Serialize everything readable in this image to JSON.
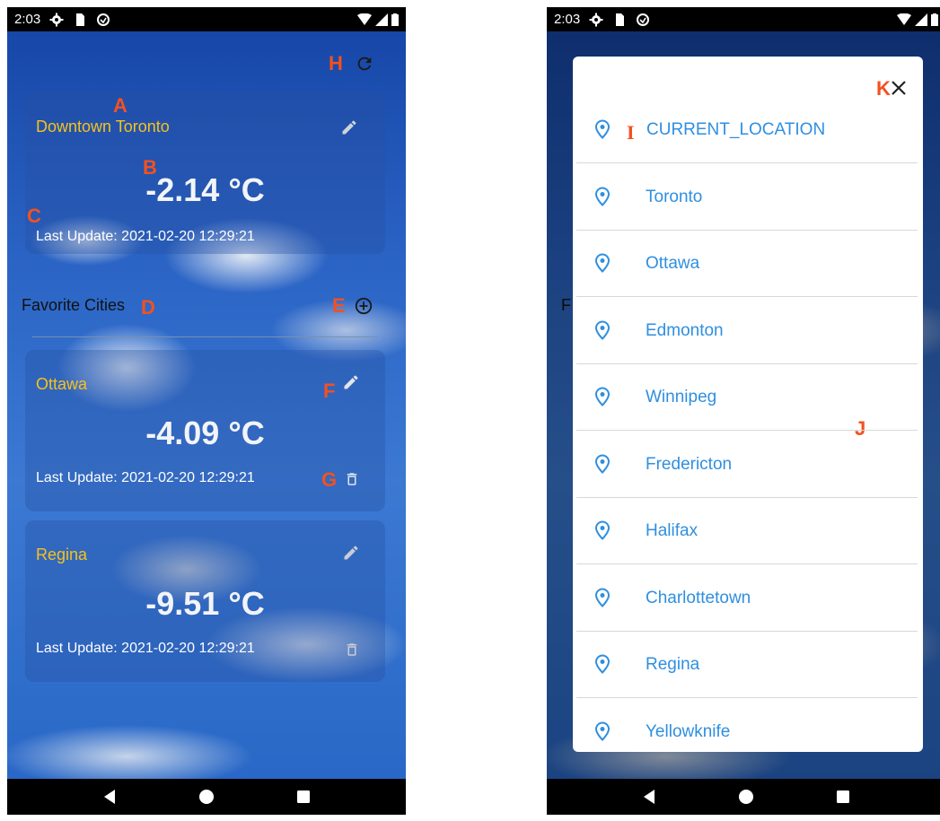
{
  "status": {
    "time": "2:03"
  },
  "left": {
    "main_card": {
      "city": "Downtown Toronto",
      "temp": "-2.14 °C",
      "updated": "Last Update: 2021-02-20 12:29:21"
    },
    "favorites_title": "Favorite Cities",
    "favorites": [
      {
        "city": "Ottawa",
        "temp": "-4.09 °C",
        "updated": "Last Update: 2021-02-20 12:29:21"
      },
      {
        "city": "Regina",
        "temp": "-9.51 °C",
        "updated": "Last Update: 2021-02-20 12:29:21"
      }
    ]
  },
  "right": {
    "cities": [
      "CURRENT_LOCATION",
      "Toronto",
      "Ottawa",
      "Edmonton",
      "Winnipeg",
      "Fredericton",
      "Halifax",
      "Charlottetown",
      "Regina",
      "Yellowknife"
    ],
    "background_peek_letter": "F"
  },
  "markers": {
    "A": "A",
    "B": "B",
    "C": "C",
    "D": "D",
    "E": "E",
    "F": "F",
    "G": "G",
    "H": "H",
    "I": "I",
    "J": "J",
    "K": "K"
  },
  "icons": {
    "refresh": "refresh-icon",
    "edit": "pencil-icon",
    "add": "add-circle-icon",
    "delete": "trash-icon",
    "close": "close-icon",
    "pin": "location-pin-icon",
    "back": "nav-back-icon",
    "home": "nav-home-icon",
    "recents": "nav-recents-icon"
  },
  "colors": {
    "city": "#f7c21a",
    "marker": "#f4511e",
    "list_text": "#2f8fe0"
  }
}
